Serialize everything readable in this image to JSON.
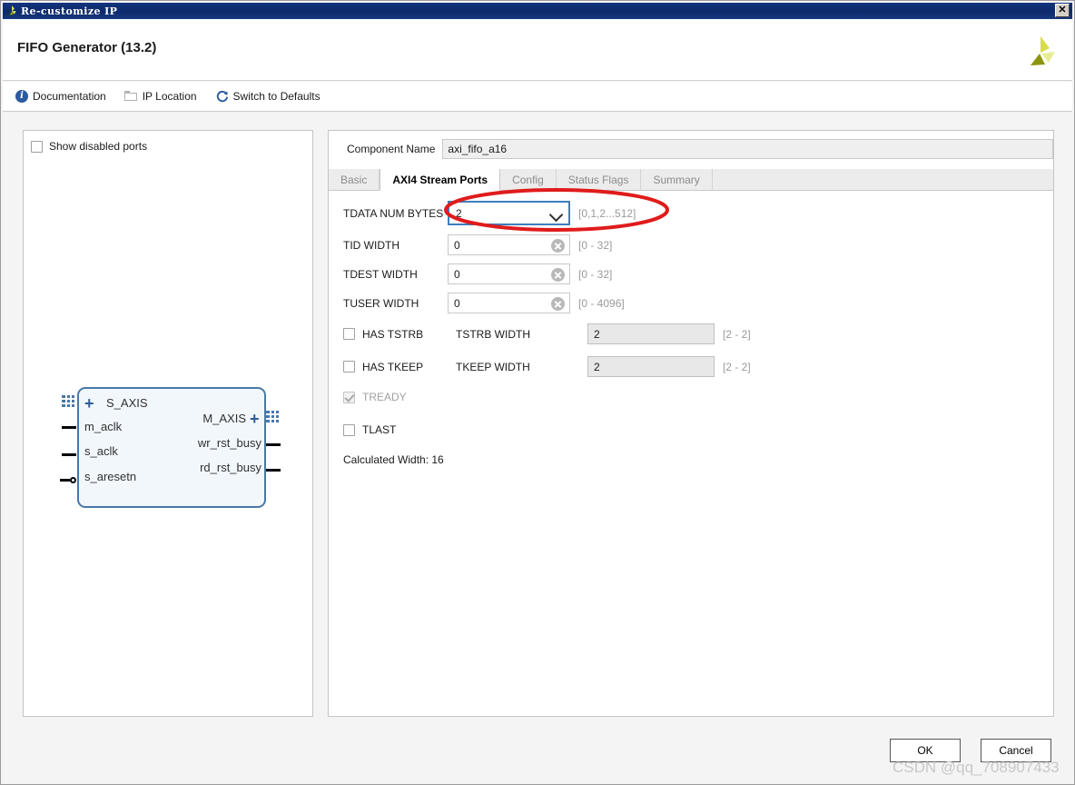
{
  "window": {
    "title": "Re-customize IP",
    "close_label": "✕"
  },
  "header": {
    "title": "FIFO Generator (13.2)",
    "logo_name": "xilinx-logo"
  },
  "toolbar": {
    "items": [
      {
        "label": "Documentation",
        "icon": "info-icon"
      },
      {
        "label": "IP Location",
        "icon": "folder-icon"
      },
      {
        "label": "Switch to Defaults",
        "icon": "refresh-icon"
      }
    ]
  },
  "left_panel": {
    "show_disabled_ports": {
      "label": "Show disabled ports",
      "checked": false
    },
    "symbol": {
      "left_ports": [
        "S_AXIS",
        "m_aclk",
        "s_aclk",
        "s_aresetn"
      ],
      "right_ports": [
        "M_AXIS",
        "wr_rst_busy",
        "rd_rst_busy"
      ]
    }
  },
  "right_panel": {
    "component_name": {
      "label": "Component Name",
      "value": "axi_fifo_a16"
    },
    "tabs": [
      {
        "label": "Basic",
        "active": false
      },
      {
        "label": "AXI4 Stream Ports",
        "active": true
      },
      {
        "label": "Config",
        "active": false
      },
      {
        "label": "Status Flags",
        "active": false
      },
      {
        "label": "Summary",
        "active": false
      }
    ],
    "fields": {
      "tdata_num_bytes": {
        "label": "TDATA NUM BYTES",
        "value": "2",
        "range": "[0,1,2...512]"
      },
      "tid_width": {
        "label": "TID WIDTH",
        "value": "0",
        "range": "[0 - 32]"
      },
      "tdest_width": {
        "label": "TDEST WIDTH",
        "value": "0",
        "range": "[0 - 32]"
      },
      "tuser_width": {
        "label": "TUSER WIDTH",
        "value": "0",
        "range": "[0 - 4096]"
      },
      "has_tstrb": {
        "label": "HAS TSTRB",
        "checked": false,
        "width_label": "TSTRB WIDTH",
        "width_value": "2",
        "range": "[2 - 2]"
      },
      "has_tkeep": {
        "label": "HAS TKEEP",
        "checked": false,
        "width_label": "TKEEP WIDTH",
        "width_value": "2",
        "range": "[2 - 2]"
      },
      "tready": {
        "label": "TREADY",
        "checked": true,
        "disabled": true
      },
      "tlast": {
        "label": "TLAST",
        "checked": false,
        "disabled": false
      }
    },
    "calculated_width": "Calculated Width: 16"
  },
  "footer": {
    "ok_label": "OK",
    "cancel_label": "Cancel"
  },
  "watermark": "CSDN @qq_708907433",
  "colors": {
    "titlebar": "#14357e",
    "accent_blue": "#2c5aa0",
    "annotation_red": "#e01b1b",
    "symbol_border": "#4878a8",
    "focus_border": "#3d7ebd"
  }
}
